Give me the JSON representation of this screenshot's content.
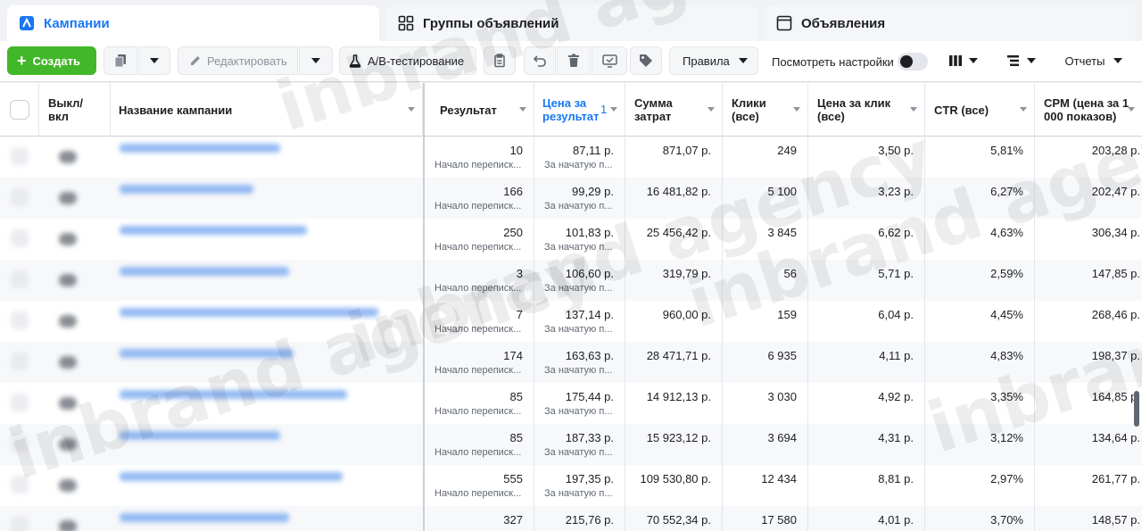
{
  "tabs": [
    {
      "label": "Кампании",
      "icon": "campaign-flag-icon"
    },
    {
      "label": "Группы объявлений",
      "icon": "adset-grid-icon"
    },
    {
      "label": "Объявления",
      "icon": "ad-window-icon"
    }
  ],
  "toolbar": {
    "create_label": "Создать",
    "edit_label": "Редактировать",
    "ab_label": "A/B-тестирование",
    "rules_label": "Правила",
    "view_settings_label": "Посмотреть настройки",
    "reports_label": "Отчеты"
  },
  "columns": {
    "toggle": "Выкл/ вкл",
    "name": "Название кампании",
    "result": "Результат",
    "cost_per_result": "Цена за результат",
    "sort_index": "1",
    "spent": "Сумма затрат",
    "clicks": "Клики (все)",
    "cpc": "Цена за клик (все)",
    "ctr": "CTR (все)",
    "cpm": "CPM (цена за 1 000 показов)"
  },
  "rows": [
    {
      "result": "10",
      "result_sub": "Начало переписк...",
      "cpr": "87,11 р.",
      "cpr_sub": "За начатую п...",
      "spent": "871,07 р.",
      "clicks": "249",
      "cpc": "3,50 р.",
      "ctr": "5,81%",
      "cpm": "203,28 р."
    },
    {
      "result": "166",
      "result_sub": "Начало переписк...",
      "cpr": "99,29 р.",
      "cpr_sub": "За начатую п...",
      "spent": "16 481,82 р.",
      "clicks": "5 100",
      "cpc": "3,23 р.",
      "ctr": "6,27%",
      "cpm": "202,47 р."
    },
    {
      "result": "250",
      "result_sub": "Начало переписк...",
      "cpr": "101,83 р.",
      "cpr_sub": "За начатую п...",
      "spent": "25 456,42 р.",
      "clicks": "3 845",
      "cpc": "6,62 р.",
      "ctr": "4,63%",
      "cpm": "306,34 р."
    },
    {
      "result": "3",
      "result_sub": "Начало переписк...",
      "cpr": "106,60 р.",
      "cpr_sub": "За начатую п...",
      "spent": "319,79 р.",
      "clicks": "56",
      "cpc": "5,71 р.",
      "ctr": "2,59%",
      "cpm": "147,85 р."
    },
    {
      "result": "7",
      "result_sub": "Начало переписк...",
      "cpr": "137,14 р.",
      "cpr_sub": "За начатую п...",
      "spent": "960,00 р.",
      "clicks": "159",
      "cpc": "6,04 р.",
      "ctr": "4,45%",
      "cpm": "268,46 р."
    },
    {
      "result": "174",
      "result_sub": "Начало переписк...",
      "cpr": "163,63 р.",
      "cpr_sub": "За начатую п...",
      "spent": "28 471,71 р.",
      "clicks": "6 935",
      "cpc": "4,11 р.",
      "ctr": "4,83%",
      "cpm": "198,37 р."
    },
    {
      "result": "85",
      "result_sub": "Начало переписк...",
      "cpr": "175,44 р.",
      "cpr_sub": "За начатую п...",
      "spent": "14 912,13 р.",
      "clicks": "3 030",
      "cpc": "4,92 р.",
      "ctr": "3,35%",
      "cpm": "164,85 р."
    },
    {
      "result": "85",
      "result_sub": "Начало переписк...",
      "cpr": "187,33 р.",
      "cpr_sub": "За начатую п...",
      "spent": "15 923,12 р.",
      "clicks": "3 694",
      "cpc": "4,31 р.",
      "ctr": "3,12%",
      "cpm": "134,64 р."
    },
    {
      "result": "555",
      "result_sub": "Начало переписк...",
      "cpr": "197,35 р.",
      "cpr_sub": "За начатую п...",
      "spent": "109 530,80 р.",
      "clicks": "12 434",
      "cpc": "8,81 р.",
      "ctr": "2,97%",
      "cpm": "261,77 р."
    },
    {
      "result": "327",
      "result_sub": "",
      "cpr": "215,76 р.",
      "cpr_sub": "",
      "spent": "70 552,34 р.",
      "clicks": "17 580",
      "cpc": "4,01 р.",
      "ctr": "3,70%",
      "cpm": "148,57 р."
    }
  ],
  "watermark": "inbrand agency",
  "colors": {
    "accent": "#1877f2",
    "create": "#42b72a"
  }
}
